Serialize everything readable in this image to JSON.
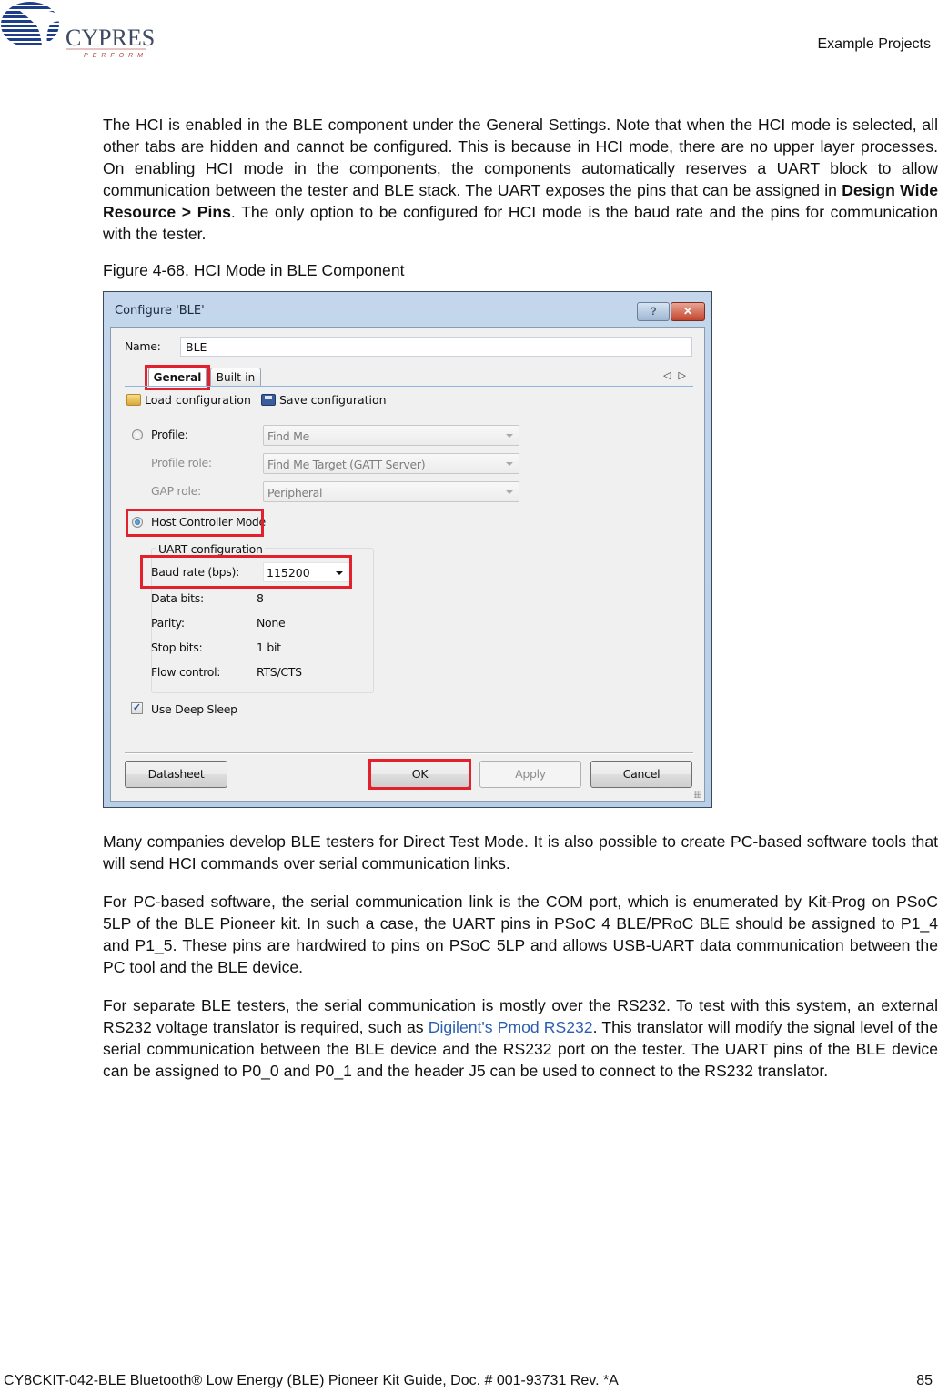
{
  "header": {
    "logo_text": "CYPRESS",
    "logo_tagline": "PERFORM",
    "section_title": "Example Projects"
  },
  "colors": {
    "highlight_red": "#e2212c",
    "link_blue": "#2a5db0",
    "logo_blue": "#1d3e8a"
  },
  "body": {
    "p1_part1": "The HCI is enabled in the BLE component under the General Settings. Note that when the HCI mode is selected, all other tabs are hidden and cannot be configured. This is because in HCI mode, there are no upper layer processes. On enabling HCI mode in the components, the components automatically reserves a UART block to allow communication between the tester and BLE stack. The UART exposes the pins that can be assigned in ",
    "p1_bold": "Design Wide Resource > Pins",
    "p1_part2": ". The only option to be configured for HCI mode is the baud rate and the pins for communication with the tester.",
    "figure_caption": "Figure 4-68.  HCI Mode in BLE Component",
    "p2": "Many companies develop BLE testers for Direct Test Mode. It is also possible to create PC-based software tools that will send HCI commands over serial communication links.",
    "p3": "For PC-based software, the serial communication link is the COM port, which is enumerated by Kit-Prog on PSoC 5LP of the BLE Pioneer kit. In such a case, the UART pins in PSoC 4 BLE/PRoC BLE should be assigned to P1_4 and P1_5. These pins are hardwired to pins on PSoC 5LP and allows USB-UART data communication between the PC tool and the BLE device.",
    "p4_part1": "For separate BLE testers, the serial communication is mostly over the RS232. To test with this system, an external RS232 voltage translator is required, such as ",
    "p4_link": "Digilent's Pmod RS232",
    "p4_part2": ". This translator will modify the signal level of the serial communication between the BLE device and the RS232 port on the tester. The UART pins of the BLE device can be assigned to P0_0 and P0_1 and the header J5 can be used to connect to the RS232 translator."
  },
  "dialog": {
    "title": "Configure 'BLE'",
    "help_label": "?",
    "close_label": "✕",
    "name_label": "Name:",
    "name_value": "BLE",
    "tabs": [
      {
        "label": "General",
        "active": true
      },
      {
        "label": "Built-in",
        "active": false
      }
    ],
    "nav_arrows": "◁▷",
    "toolbar": {
      "load_label": "Load configuration",
      "save_label": "Save configuration"
    },
    "profile": {
      "radio_label": "Profile:",
      "selected": false,
      "profile_value": "Find Me",
      "role_label": "Profile role:",
      "role_value": "Find Me Target (GATT Server)",
      "gap_label": "GAP role:",
      "gap_value": "Peripheral"
    },
    "hci": {
      "radio_label": "Host Controller Mode",
      "selected": true
    },
    "uart": {
      "group_title": "UART configuration",
      "baud_label": "Baud rate (bps):",
      "baud_value": "115200",
      "rows": [
        {
          "label": "Data bits:",
          "value": "8"
        },
        {
          "label": "Parity:",
          "value": "None"
        },
        {
          "label": "Stop bits:",
          "value": "1 bit"
        },
        {
          "label": "Flow control:",
          "value": "RTS/CTS"
        }
      ]
    },
    "deep_sleep": {
      "label": "Use Deep Sleep",
      "checked": true,
      "check_glyph": "✓"
    },
    "buttons": {
      "datasheet": "Datasheet",
      "ok": "OK",
      "apply": "Apply",
      "cancel": "Cancel"
    }
  },
  "footer": {
    "doc_info": "CY8CKIT-042-BLE Bluetooth® Low Energy (BLE) Pioneer Kit Guide, Doc. # 001-93731 Rev. *A",
    "page_number": "85"
  }
}
